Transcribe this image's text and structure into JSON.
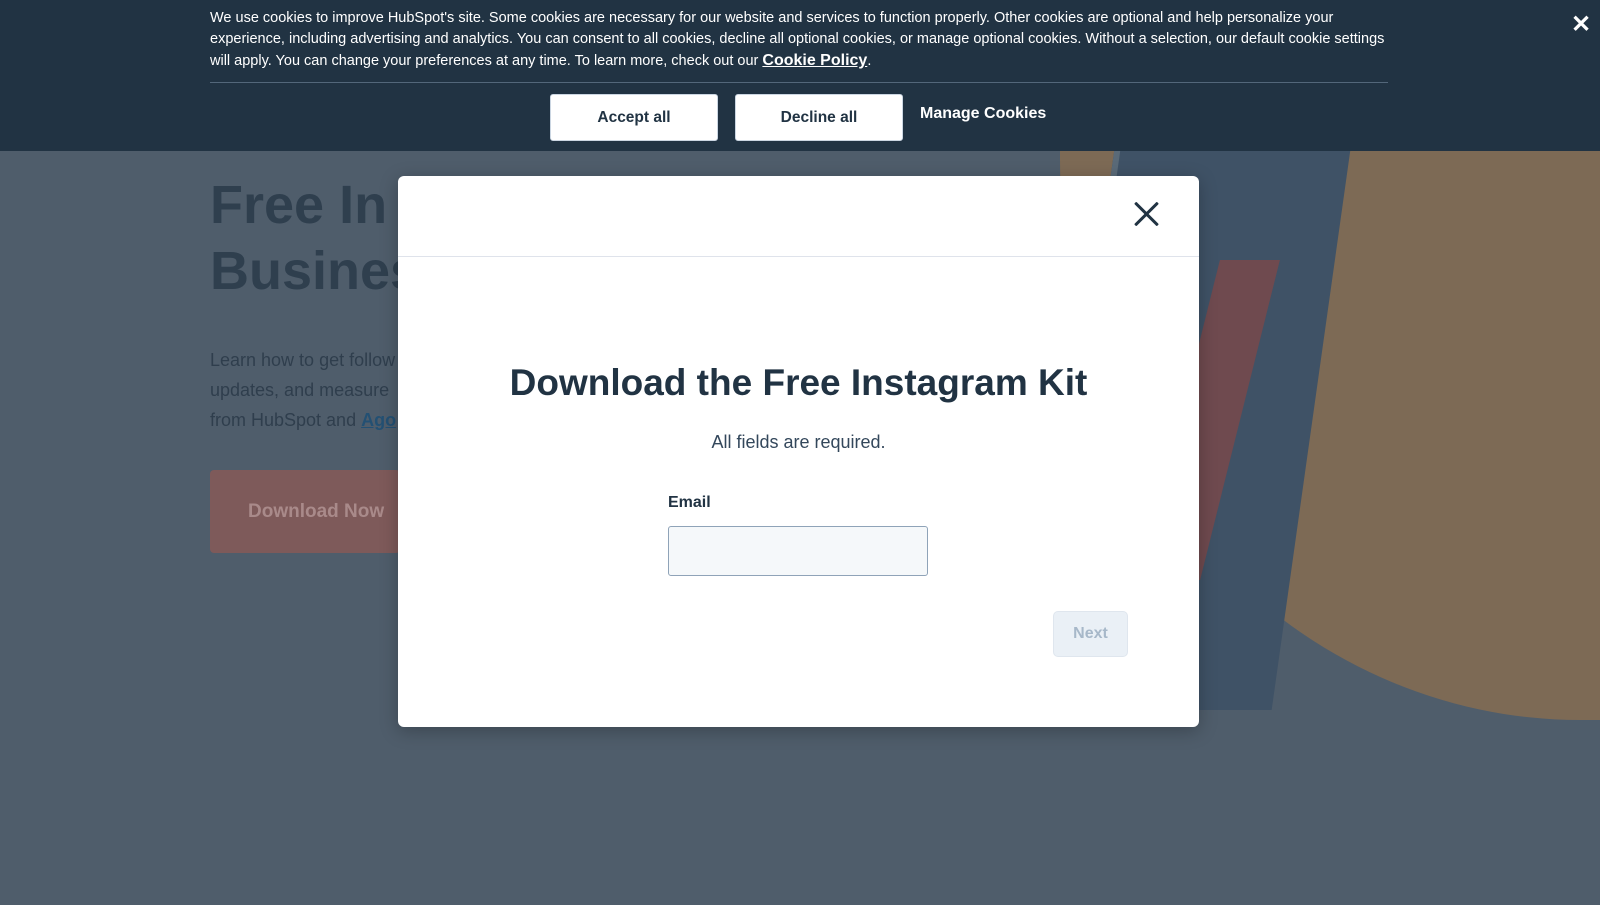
{
  "cookie_banner": {
    "text": "We use cookies to improve HubSpot's site. Some cookies are necessary for our website and services to function properly. Other cookies are optional and help personalize your experience, including advertising and analytics. You can consent to all cookies, decline all optional cookies, or manage optional cookies. Without a selection, our default cookie settings will apply. You can change your preferences at any time. To learn more, check out our ",
    "policy_link": "Cookie Policy",
    "period": ".",
    "accept_label": "Accept all",
    "decline_label": "Decline all",
    "manage_label": "Manage Cookies",
    "close_glyph": "✕"
  },
  "background": {
    "title_line1": "Free In",
    "title_line2": "Busines",
    "desc_line1": "Learn how to get follow",
    "desc_line2": "updates, and measure",
    "desc_line3_prefix": "from HubSpot and ",
    "desc_link": "Ago",
    "download_label": "Download Now"
  },
  "modal": {
    "title": "Download the Free Instagram Kit",
    "subtitle": "All fields are required.",
    "email_label": "Email",
    "email_value": "",
    "next_label": "Next"
  },
  "colors": {
    "banner_bg": "#213343",
    "overlay_bg": "#4f5d6b",
    "modal_bg": "#ffffff",
    "text_dark": "#213343"
  }
}
